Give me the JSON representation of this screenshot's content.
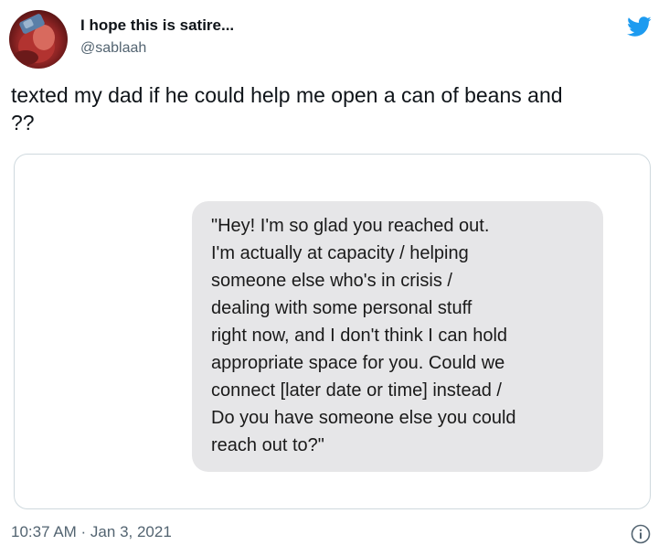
{
  "author": {
    "display_name": "I hope this is satire...",
    "handle": "@sablaah",
    "avatar_icon": "profile-avatar"
  },
  "platform_icon": "twitter-bird-icon",
  "tweet": {
    "text": "texted my dad if he could help me open a can of beans and\n??"
  },
  "media": {
    "message_text": "\"Hey! I'm so glad you reached out.\nI'm actually at capacity / helping\nsomeone else who's in crisis /\ndealing with some personal stuff\nright now, and I don't think I can hold\nappropriate space for you. Could we\nconnect [later date or time] instead /\nDo you have someone else you could\nreach out to?\""
  },
  "footer": {
    "timestamp": "10:37 AM · Jan 3, 2021",
    "info_icon": "info-icon"
  },
  "colors": {
    "twitter_blue": "#1d9bf0",
    "bubble_gray": "#e6e6e8",
    "secondary_text": "#536471",
    "border": "#cfd9de"
  }
}
